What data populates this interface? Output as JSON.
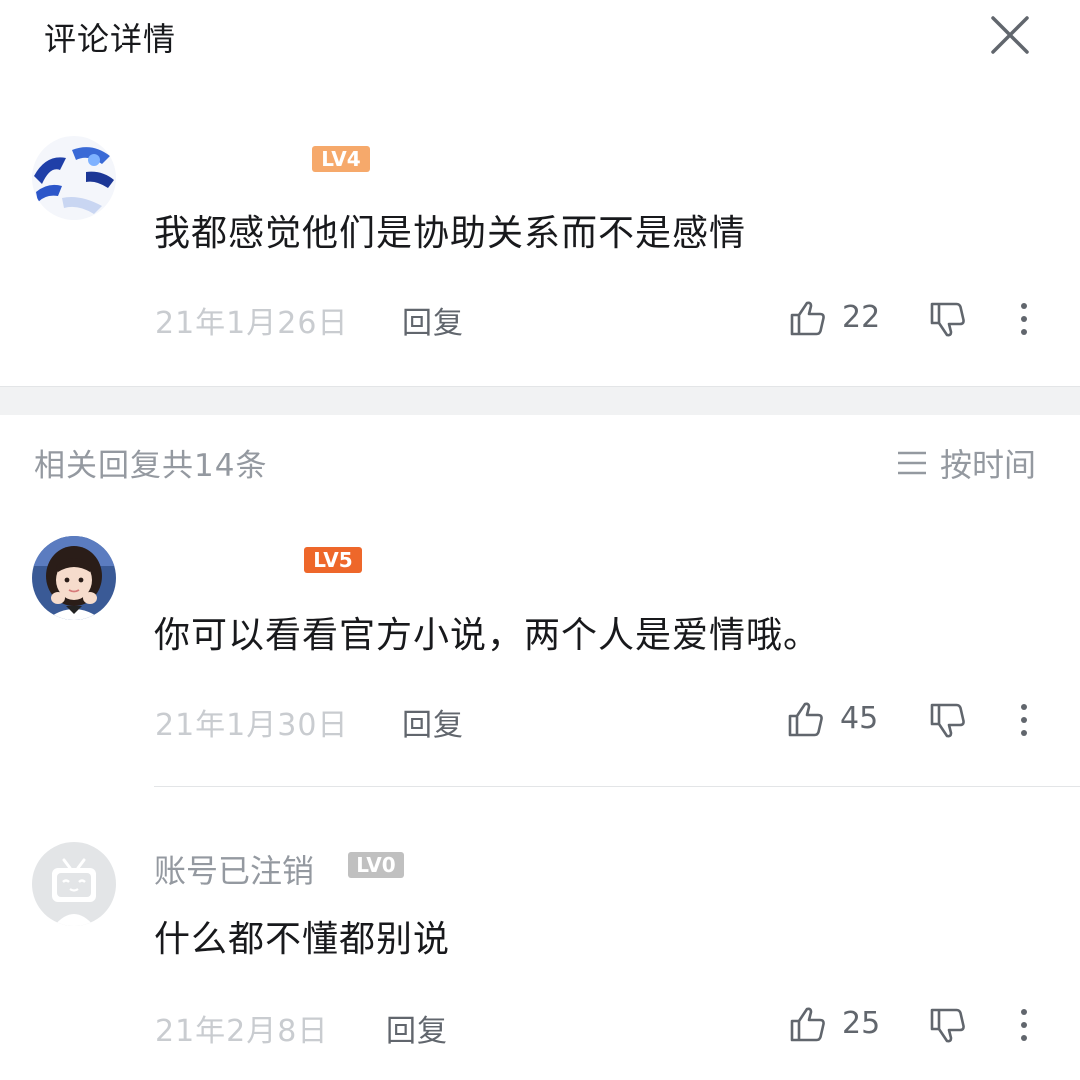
{
  "header": {
    "title": "评论详情"
  },
  "main_comment": {
    "level": "LV4",
    "level_color": "#f6a96b",
    "content": "我都感觉他们是协助关系而不是感情",
    "date": "21年1月26日",
    "reply_label": "回复",
    "likes": "22"
  },
  "replies_header": {
    "count_label": "相关回复共14条",
    "sort_label": "按时间"
  },
  "replies": [
    {
      "level": "LV5",
      "level_color": "#ee672a",
      "content": "你可以看看官方小说，两个人是爱情哦。",
      "date": "21年1月30日",
      "reply_label": "回复",
      "likes": "45"
    },
    {
      "username": "账号已注销",
      "level": "LV0",
      "level_color": "#c0c0c0",
      "content": "什么都不懂都别说",
      "date": "21年2月8日",
      "reply_label": "回复",
      "likes": "25"
    }
  ]
}
